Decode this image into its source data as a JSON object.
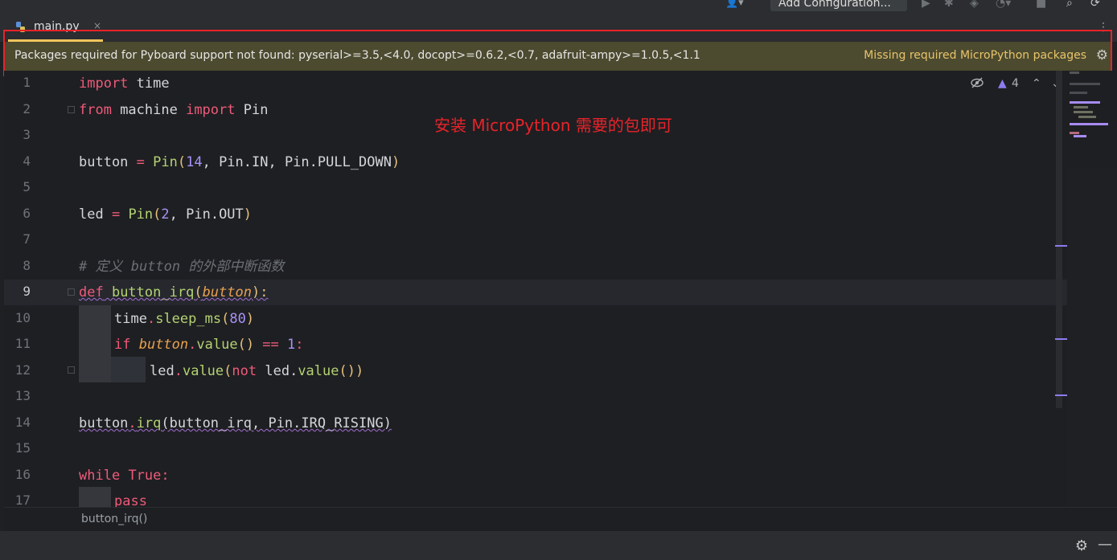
{
  "toolbar": {
    "config_label": "Add Configuration...",
    "icons": [
      "user-icon",
      "run-icon",
      "debug-icon",
      "coverage-icon",
      "profile-icon",
      "stop-icon",
      "search-icon",
      "update-icon"
    ]
  },
  "tabs": [
    {
      "label": "main.py",
      "close": "×",
      "icon": "python-file-icon"
    }
  ],
  "tabbar_menu": "⋮",
  "banner": {
    "message": "Packages required for Pyboard support not found: pyserial>=3.5,<4.0, docopt>=0.6.2,<0.7, adafruit-ampy>=1.0.5,<1.1",
    "action": "Missing required MicroPython packages",
    "gear": "⚙",
    "highlight_color": "#e8232a"
  },
  "annotation": "安装 MicroPython 需要的包即可",
  "inspections": {
    "hidden_icon": "eye-off-icon",
    "warning_count": "4",
    "up": "⌃",
    "down": "⌄"
  },
  "editor": {
    "line_numbers": [
      "1",
      "2",
      "3",
      "4",
      "5",
      "6",
      "7",
      "8",
      "9",
      "10",
      "11",
      "12",
      "13",
      "14",
      "15",
      "16",
      "17"
    ],
    "active_line": "9",
    "code": {
      "l1": {
        "kw": "import",
        "rest": " time"
      },
      "l2": {
        "kw1": "from",
        "mid": " machine ",
        "kw2": "import",
        "rest": " Pin"
      },
      "l4": {
        "a": "button",
        "eq": " = ",
        "fn": "Pin",
        "p1": "(",
        "n": "14",
        "b": ", Pin.IN, Pin.PULL_DOWN",
        "p2": ")"
      },
      "l6": {
        "a": "led",
        "eq": " = ",
        "fn": "Pin",
        "p1": "(",
        "n": "2",
        "b": ", Pin.OUT",
        "p2": ")"
      },
      "l8": "# 定义 button 的外部中断函数",
      "l9": {
        "kw": "def",
        "name": " button_irq",
        "p1": "(",
        "param": "button",
        "p2": "):"
      },
      "l10": {
        "a": "time",
        "dot": ".",
        "fn": "sleep_ms",
        "p1": "(",
        "n": "80",
        "p2": ")"
      },
      "l11": {
        "kw": "if",
        "param": " button",
        "dot": ".",
        "fn": "value",
        "p": "()",
        "op": " == ",
        "n": "1",
        "c": ":"
      },
      "l12": {
        "a": "led",
        "dot": ".",
        "fn": "value",
        "p1": "(",
        "kw": "not",
        "b": " led.",
        "fn2": "value",
        "p2": "())"
      },
      "l14": {
        "a": "button",
        "dot": ".",
        "fn": "irq",
        "b": "(button_irq, Pin.IRQ_RISING)"
      },
      "l16": {
        "kw1": "while",
        "sp": " ",
        "kw2": "True",
        "c": ":"
      },
      "l17": {
        "kw": "pass"
      }
    }
  },
  "breadcrumb": "button_irq()",
  "status": {
    "gear": "⚙",
    "minimize": "—"
  }
}
